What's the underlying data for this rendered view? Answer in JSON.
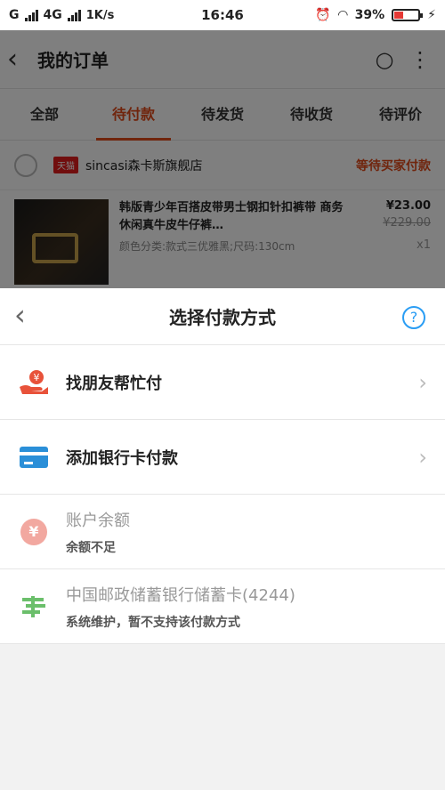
{
  "status_bar": {
    "carrier": "G",
    "network": "4G",
    "speed": "1K/s",
    "time": "16:46",
    "battery": "39%",
    "battery_level": 0.39
  },
  "background": {
    "title": "我的订单",
    "tabs": [
      "全部",
      "待付款",
      "待发货",
      "待收货",
      "待评价"
    ],
    "active_tab": 1,
    "shop": {
      "badge": "天猫",
      "name": "sincasi森卡斯旗舰店",
      "status": "等待买家付款"
    },
    "product": {
      "name": "韩版青少年百搭皮带男士钢扣针扣裤带 商务休闲真牛皮牛仔裤…",
      "spec": "颜色分类:款式三优雅黑;尺码:130cm",
      "price": "¥23.00",
      "original_price": "¥229.00",
      "quantity": "x1"
    }
  },
  "sheet": {
    "title": "选择付款方式",
    "help": "?",
    "options": [
      {
        "label": "找朋友帮忙付",
        "sub": "",
        "icon": "friend-pay-icon",
        "disabled": false
      },
      {
        "label": "添加银行卡付款",
        "sub": "",
        "icon": "bank-card-icon",
        "disabled": false
      },
      {
        "label": "账户余额",
        "sub": "余额不足",
        "icon": "yen-icon",
        "disabled": true
      },
      {
        "label": "中国邮政储蓄银行储蓄卡(4244)",
        "sub": "系统维护，暂不支持该付款方式",
        "icon": "postal-bank-icon",
        "disabled": true
      }
    ]
  },
  "colors": {
    "accent": "#e04a1a",
    "link_blue": "#2a9df4",
    "card_blue": "#2a8fd8",
    "yen_pink": "#f2a8a0",
    "postal_green": "#6bbf6b"
  }
}
